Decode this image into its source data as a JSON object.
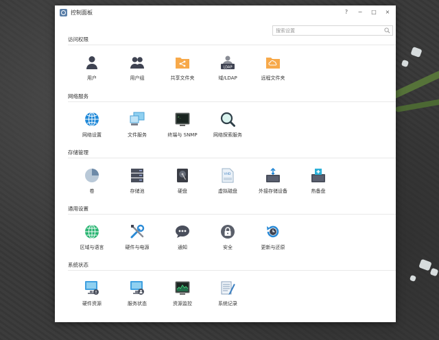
{
  "window": {
    "title": "控制面板",
    "buttons": {
      "help": "?",
      "minimize": "−",
      "maximize": "□",
      "close": "×"
    }
  },
  "search": {
    "placeholder": "搜索设置",
    "value": ""
  },
  "sections": [
    {
      "title": "访问权限",
      "items": [
        {
          "label": "用户",
          "icon": "user-icon"
        },
        {
          "label": "用户组",
          "icon": "user-group-icon"
        },
        {
          "label": "共享文件夹",
          "icon": "shared-folder-icon"
        },
        {
          "label": "域/LDAP",
          "icon": "ldap-icon"
        },
        {
          "label": "远程文件夹",
          "icon": "remote-folder-icon"
        }
      ]
    },
    {
      "title": "网络服务",
      "items": [
        {
          "label": "网络设置",
          "icon": "network-globe-icon"
        },
        {
          "label": "文件服务",
          "icon": "file-service-icon"
        },
        {
          "label": "终端与 SNMP",
          "icon": "terminal-icon"
        },
        {
          "label": "网络探索服务",
          "icon": "network-discovery-icon"
        }
      ]
    },
    {
      "title": "存储管理",
      "items": [
        {
          "label": "卷",
          "icon": "volume-pie-icon"
        },
        {
          "label": "存储池",
          "icon": "storage-pool-icon"
        },
        {
          "label": "硬盘",
          "icon": "hard-disk-icon"
        },
        {
          "label": "虚拟磁盘",
          "icon": "vhd-icon"
        },
        {
          "label": "外接存储设备",
          "icon": "usb-storage-icon"
        },
        {
          "label": "热备盘",
          "icon": "hot-spare-icon"
        }
      ]
    },
    {
      "title": "通用设置",
      "items": [
        {
          "label": "区域与语言",
          "icon": "region-globe-icon"
        },
        {
          "label": "硬件与电源",
          "icon": "tools-icon"
        },
        {
          "label": "通知",
          "icon": "notification-bubble-icon"
        },
        {
          "label": "安全",
          "icon": "lock-icon"
        },
        {
          "label": "更新与还原",
          "icon": "update-restore-icon"
        }
      ]
    },
    {
      "title": "系统状态",
      "items": [
        {
          "label": "硬件资源",
          "icon": "hardware-monitor-icon"
        },
        {
          "label": "服务状态",
          "icon": "service-status-icon"
        },
        {
          "label": "资源监控",
          "icon": "resource-monitor-icon"
        },
        {
          "label": "系统记录",
          "icon": "system-log-icon"
        }
      ]
    }
  ],
  "colors": {
    "dark_icon": "#3f4352",
    "folder_orange": "#f7a94a",
    "blue": "#2a8ad6",
    "accent_green": "#2bb673"
  }
}
